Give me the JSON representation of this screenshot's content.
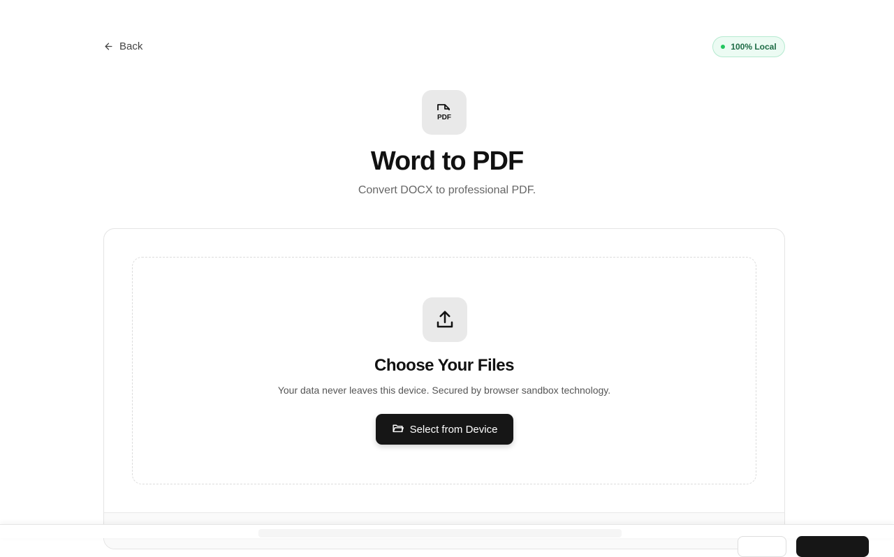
{
  "nav": {
    "back_label": "Back"
  },
  "badge": {
    "label": "100% Local",
    "dot_color": "#22c55e"
  },
  "tool": {
    "icon": "pdf-file-icon",
    "icon_text": "PDF",
    "title": "Word to PDF",
    "subtitle": "Convert DOCX to professional PDF."
  },
  "dropzone": {
    "icon": "upload-icon",
    "title": "Choose Your Files",
    "description": "Your data never leaves this device. Secured by browser sandbox technology.",
    "button_label": "Select from Device",
    "button_icon": "folder-open-icon"
  },
  "colors": {
    "accent_dark": "#161616",
    "badge_bg": "#ecfbf3",
    "badge_text": "#1d6b45"
  }
}
